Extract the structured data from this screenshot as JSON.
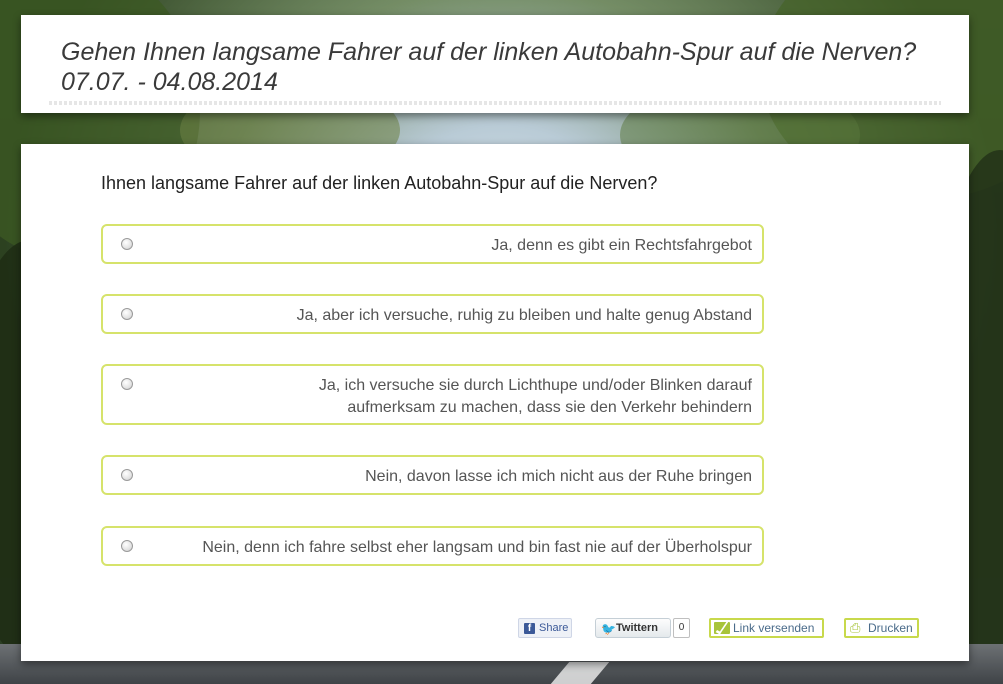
{
  "header": {
    "title_line1": "Gehen Ihnen langsame Fahrer auf der linken Autobahn-Spur auf die Nerven?",
    "title_line2": "07.07. - 04.08.2014"
  },
  "poll": {
    "question": "Ihnen langsame Fahrer auf der linken Autobahn-Spur auf die Nerven?",
    "options": [
      {
        "label": "Ja, denn es gibt ein Rechtsfahrgebot"
      },
      {
        "label": "Ja, aber ich versuche, ruhig zu bleiben und halte genug Abstand"
      },
      {
        "label": "Ja, ich versuche sie durch Lichthupe und/oder Blinken darauf aufmerksam zu machen, dass sie den Verkehr behindern"
      },
      {
        "label": "Nein, davon lasse ich mich nicht aus der Ruhe bringen"
      },
      {
        "label": "Nein, denn ich fahre selbst eher langsam und bin fast nie auf der Überholspur"
      }
    ]
  },
  "share": {
    "facebook_label": "Share",
    "twitter_label": "Twittern",
    "twitter_count": "0",
    "mail_label": "Link versenden",
    "print_label": "Drucken"
  },
  "icons": {
    "facebook": "facebook-icon",
    "twitter": "twitter-bird-icon",
    "mail": "envelope-icon",
    "print": "printer-icon",
    "radio": "radio-button"
  },
  "colors": {
    "option_border": "#d6e36b",
    "action_border": "#c8d94c",
    "facebook_blue": "#3b5998",
    "twitter_blue": "#2ea3e0"
  }
}
